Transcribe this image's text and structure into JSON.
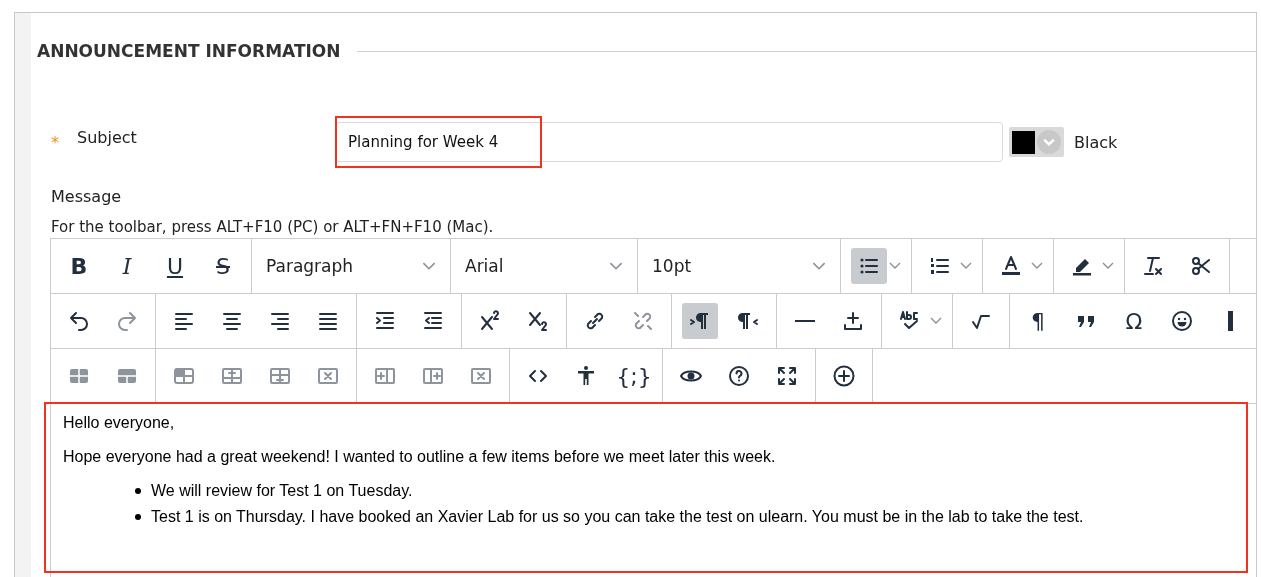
{
  "section": {
    "title": "ANNOUNCEMENT INFORMATION"
  },
  "subject": {
    "required_mark": "*",
    "label": "Subject",
    "value": "Planning for Week 4",
    "highlighted": true,
    "text_color": {
      "color": "#000000",
      "name": "Black"
    }
  },
  "message": {
    "label": "Message",
    "hint": "For the toolbar, press ALT+F10 (PC) or ALT+FN+F10 (Mac).",
    "toolbar": [
      [
        [
          {
            "kind": "button",
            "glyph": "B",
            "active": false,
            "disabled": false
          },
          {
            "kind": "button",
            "glyph": "I",
            "active": false,
            "disabled": false
          },
          {
            "kind": "button",
            "glyph": "U",
            "active": false,
            "disabled": false
          },
          {
            "kind": "button",
            "glyph": "S",
            "active": false,
            "disabled": false
          }
        ],
        [
          {
            "kind": "select",
            "value": "Paragraph"
          }
        ],
        [
          {
            "kind": "select",
            "value": "Arial"
          }
        ],
        [
          {
            "kind": "select",
            "value": "10pt"
          }
        ],
        [
          {
            "kind": "split",
            "active": true,
            "disabled": false
          }
        ],
        [
          {
            "kind": "split",
            "active": false,
            "disabled": false
          }
        ],
        [
          {
            "kind": "split",
            "active": false,
            "disabled": false
          }
        ],
        [
          {
            "kind": "split",
            "active": false,
            "disabled": false
          }
        ],
        [
          {
            "kind": "button",
            "active": false,
            "disabled": false
          },
          {
            "kind": "button",
            "active": false,
            "disabled": false
          }
        ]
      ],
      [
        [
          {
            "kind": "button",
            "active": false,
            "disabled": false
          },
          {
            "kind": "button",
            "active": false,
            "disabled": true
          }
        ],
        [
          {
            "kind": "button",
            "active": false,
            "disabled": false
          },
          {
            "kind": "button",
            "active": false,
            "disabled": false
          },
          {
            "kind": "button",
            "active": false,
            "disabled": false
          },
          {
            "kind": "button",
            "active": false,
            "disabled": false
          }
        ],
        [
          {
            "kind": "button",
            "active": false,
            "disabled": false
          },
          {
            "kind": "button",
            "active": false,
            "disabled": false
          }
        ],
        [
          {
            "kind": "button",
            "active": false,
            "disabled": false
          },
          {
            "kind": "button",
            "active": false,
            "disabled": false
          }
        ],
        [
          {
            "kind": "button",
            "active": false,
            "disabled": false
          },
          {
            "kind": "button",
            "active": false,
            "disabled": true
          }
        ],
        [
          {
            "kind": "button",
            "active": true,
            "disabled": false
          },
          {
            "kind": "button",
            "active": false,
            "disabled": false
          }
        ],
        [
          {
            "kind": "button",
            "active": false,
            "disabled": false
          },
          {
            "kind": "button",
            "active": false,
            "disabled": false
          }
        ],
        [
          {
            "kind": "split",
            "active": false,
            "disabled": false
          }
        ],
        [
          {
            "kind": "button",
            "active": false,
            "disabled": false
          }
        ],
        [
          {
            "kind": "button",
            "glyph": "¶",
            "active": false,
            "disabled": false
          },
          {
            "kind": "button",
            "active": false,
            "disabled": false
          },
          {
            "kind": "button",
            "glyph": "Ω",
            "active": false,
            "disabled": false
          },
          {
            "kind": "button",
            "active": false,
            "disabled": false
          },
          {
            "kind": "button",
            "active": false,
            "disabled": false
          }
        ]
      ],
      [
        [
          {
            "kind": "button",
            "active": false,
            "disabled": true
          },
          {
            "kind": "button",
            "active": false,
            "disabled": true
          }
        ],
        [
          {
            "kind": "button",
            "active": false,
            "disabled": true
          },
          {
            "kind": "button",
            "active": false,
            "disabled": true
          },
          {
            "kind": "button",
            "active": false,
            "disabled": true
          },
          {
            "kind": "button",
            "active": false,
            "disabled": true
          }
        ],
        [
          {
            "kind": "button",
            "active": false,
            "disabled": true
          },
          {
            "kind": "button",
            "active": false,
            "disabled": true
          },
          {
            "kind": "button",
            "active": false,
            "disabled": true
          }
        ],
        [
          {
            "kind": "button",
            "active": false,
            "disabled": false
          },
          {
            "kind": "button",
            "active": false,
            "disabled": false
          },
          {
            "kind": "button",
            "glyph": "{;}",
            "active": false,
            "disabled": false
          }
        ],
        [
          {
            "kind": "button",
            "active": false,
            "disabled": false
          },
          {
            "kind": "button",
            "active": false,
            "disabled": false
          },
          {
            "kind": "button",
            "active": false,
            "disabled": false
          }
        ],
        [
          {
            "kind": "button",
            "active": false,
            "disabled": false
          }
        ]
      ]
    ],
    "body": {
      "highlighted": true,
      "paragraphs": [
        "Hello everyone,",
        "Hope everyone had a great weekend! I wanted to outline a few items before we meet later this week."
      ],
      "bullets": [
        "We will review for Test 1 on Tuesday.",
        "Test 1 is on Thursday. I have booked an Xavier Lab for us so you can take the test on ulearn. You must be in the lab to take the test."
      ]
    }
  }
}
